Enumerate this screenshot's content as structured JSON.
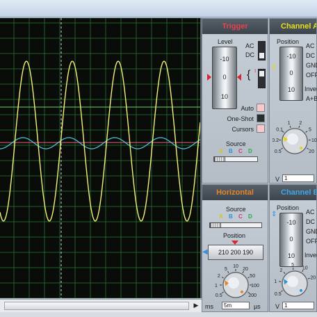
{
  "colors": {
    "screen_bg": "#0a0c0a",
    "grid": "#2e7d3a",
    "trace_a": "#f2f27a",
    "trace_b": "#52c9e0",
    "trigger_line": "#e0607a",
    "level_line": "#6fd06a"
  },
  "trigger": {
    "title": "Trigger",
    "level_label": "Level",
    "level_ticks": [
      "-10",
      "0",
      "10"
    ],
    "coupling": [
      "AC",
      "DC"
    ],
    "auto_label": "Auto",
    "oneshot_label": "One-Shot",
    "cursors_label": "Cursors",
    "source_label": "Source",
    "sources": [
      "A",
      "B",
      "C",
      "D"
    ]
  },
  "channel_a": {
    "title": "Channel A",
    "position_label": "Position",
    "position_ticks": [
      "-10",
      "0",
      "10"
    ],
    "coupling": [
      "AC",
      "DC",
      "GND",
      "OFF"
    ],
    "invert_label": "Invert",
    "ab_label": "A+B",
    "dial_ticks": [
      "0.5",
      "0.2",
      "0.1",
      "1",
      "2",
      "5",
      "10",
      "20"
    ],
    "unit": "V",
    "value": "1"
  },
  "horizontal": {
    "title": "Horizontal",
    "source_label": "Source",
    "sources": [
      "A",
      "B",
      "C",
      "D"
    ],
    "position_label": "Position",
    "position_values": [
      "210",
      "200",
      "190"
    ],
    "dial_ticks": [
      "0.5",
      "1",
      "2",
      "5",
      "10",
      "20",
      "50",
      "100",
      "200"
    ],
    "unit_left": "ms",
    "unit_right": "µs",
    "value": "5m"
  },
  "channel_b": {
    "title": "Channel B",
    "position_label": "Position",
    "position_ticks": [
      "-10",
      "0",
      "10"
    ],
    "coupling": [
      "AC",
      "DC",
      "GND",
      "OFF"
    ],
    "invert_label": "Invert",
    "dial_ticks": [
      "0.5",
      "1",
      "2",
      "5",
      "10",
      "20"
    ],
    "unit": "V",
    "value": "1"
  }
}
